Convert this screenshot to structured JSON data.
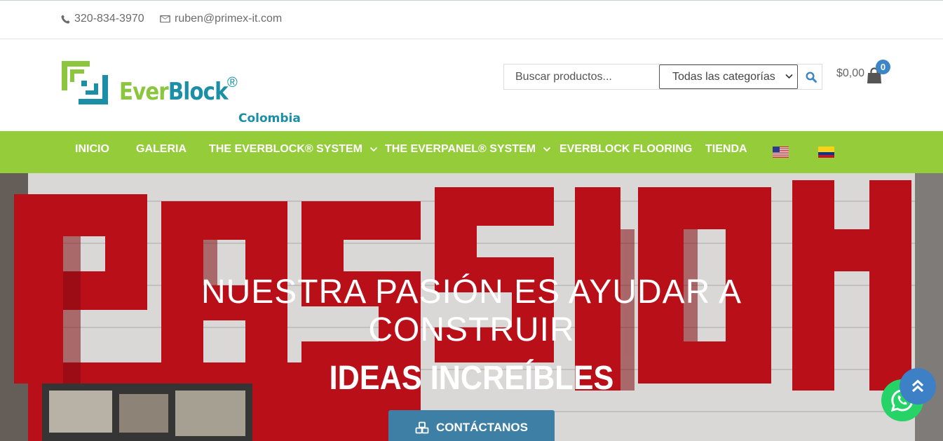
{
  "topbar": {
    "phone": "320-834-3970",
    "email": "ruben@primex-it.com",
    "phone_icon": "phone-icon",
    "email_icon": "envelope-icon"
  },
  "logo": {
    "ever": "Ever",
    "block": "Block",
    "registered": "®",
    "sub": "Colombia"
  },
  "search": {
    "placeholder": "Buscar productos...",
    "category": "Todas las categorías",
    "icon": "search-icon"
  },
  "cart": {
    "total": "$0,00",
    "count": "0",
    "icon": "shopping-bag-icon"
  },
  "nav": {
    "items": [
      {
        "label": "INICIO"
      },
      {
        "label": "GALERIA"
      },
      {
        "label": "THE EVERBLOCK® SYSTEM"
      },
      {
        "label": "THE EVERPANEL® SYSTEM"
      },
      {
        "label": "EVERBLOCK FLOORING"
      },
      {
        "label": "TIENDA"
      }
    ],
    "flags": [
      "us-flag-icon",
      "colombia-flag-icon"
    ]
  },
  "hero": {
    "line1a": "NUESTRA PASIÓN ES AYUDAR A",
    "line1b": "CONSTRUIR",
    "line2": "IDEAS INCREÍBLES",
    "cta": "CONTÁCTANOS"
  },
  "colors": {
    "nav_green": "#94cc3a",
    "brand_teal": "#1a8fa6",
    "brand_green": "#8cc63f",
    "cta_blue": "#3e7fa6",
    "badge_blue": "#3c86c7"
  }
}
